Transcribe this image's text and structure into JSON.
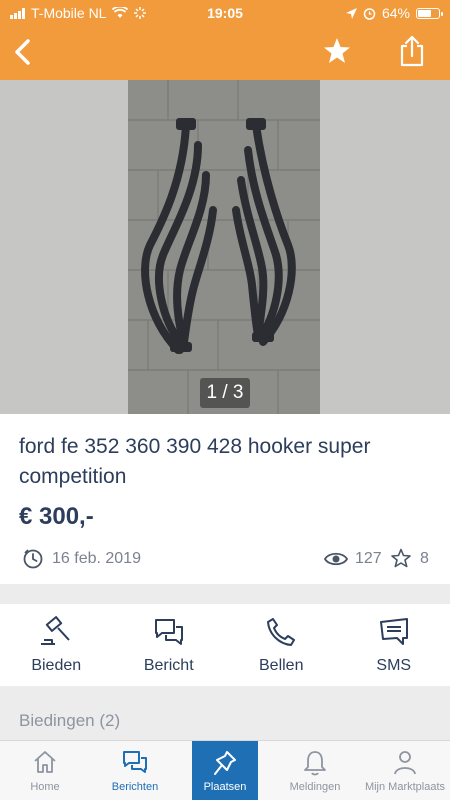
{
  "status_bar": {
    "carrier": "T-Mobile NL",
    "time": "19:05",
    "battery": "64%"
  },
  "nav": {
    "back_icon": "chevron-left-icon",
    "favorite_icon": "star-icon",
    "share_icon": "share-icon"
  },
  "gallery": {
    "counter": "1 / 3",
    "current": 1,
    "total": 3
  },
  "listing": {
    "title": "ford fe  352 360 390 428 hooker super competition",
    "price": "€ 300,-",
    "date": "16 feb. 2019",
    "views": "127",
    "favorites": "8"
  },
  "actions": [
    {
      "label": "Bieden",
      "icon": "gavel-icon"
    },
    {
      "label": "Bericht",
      "icon": "chat-icon"
    },
    {
      "label": "Bellen",
      "icon": "phone-icon"
    },
    {
      "label": "SMS",
      "icon": "sms-icon"
    }
  ],
  "offers": {
    "label": "Biedingen (2)"
  },
  "tabbar": [
    {
      "label": "Home",
      "icon": "home-icon"
    },
    {
      "label": "Berichten",
      "icon": "messages-icon",
      "active": true
    },
    {
      "label": "Plaatsen",
      "icon": "pin-icon"
    },
    {
      "label": "Meldingen",
      "icon": "bell-icon"
    },
    {
      "label": "Mijn Marktplaats",
      "icon": "user-icon"
    }
  ],
  "colors": {
    "header": "#f29b3c",
    "primary_text": "#2c3e5c",
    "accent": "#1f6fb5",
    "muted": "#8e94a0"
  }
}
